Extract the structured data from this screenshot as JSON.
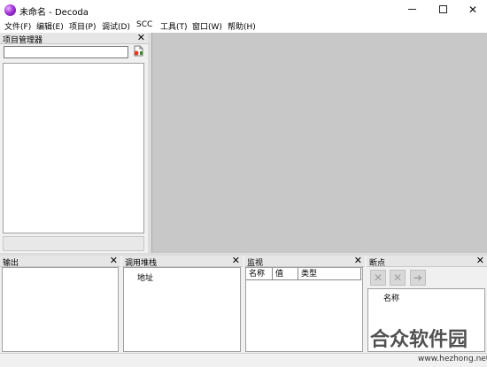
{
  "window": {
    "title": "未命名 - Decoda",
    "minimize_glyph": "",
    "close_glyph": "✕"
  },
  "menu": [
    "文件(F)",
    "编辑(E)",
    "项目(P)",
    "调试(D)",
    "SCC",
    "工具(T)",
    "窗口(W)",
    "帮助(H)"
  ],
  "panels": {
    "project": {
      "title": "项目管理器",
      "close": "✕",
      "search_value": ""
    },
    "output": {
      "title": "输出",
      "close": "✕"
    },
    "callstack": {
      "title": "调用堆栈",
      "close": "✕",
      "column": "地址"
    },
    "watch": {
      "title": "监视",
      "close": "✕",
      "columns": [
        "名称",
        "值",
        "类型"
      ]
    },
    "breakpoints": {
      "title": "断点",
      "close": "✕",
      "column": "名称"
    }
  },
  "watermark": {
    "logo_text": "合众软件园",
    "url": "www.hezhong.net"
  },
  "icons": {
    "app": "decoda-app-icon",
    "project_add": "add-file-icon",
    "bp_delete": "delete-icon",
    "bp_delete_all": "delete-all-icon",
    "bp_goto": "goto-icon"
  },
  "colors": {
    "editor_bg": "#c8c8c8",
    "panel_header": "#e6e6e6",
    "window_bg": "#ffffff"
  }
}
